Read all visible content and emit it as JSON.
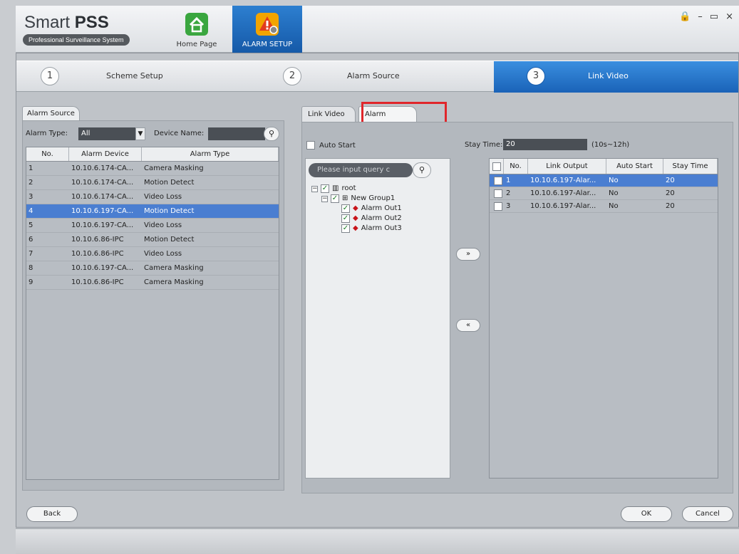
{
  "app": {
    "title_light": "Smart ",
    "title_bold": "PSS",
    "subtitle": "Professional Surveillance System"
  },
  "nav": {
    "home_label": "Home Page",
    "alarm_label": "ALARM SETUP"
  },
  "window_controls": {
    "lock": "🔒",
    "minimize": "–",
    "maximize": "▭",
    "close": "×"
  },
  "steps": [
    {
      "num": "1",
      "label": "Scheme Setup"
    },
    {
      "num": "2",
      "label": "Alarm Source"
    },
    {
      "num": "3",
      "label": "Link Video"
    }
  ],
  "alarm_source": {
    "tab_label": "Alarm Source",
    "alarm_type_label": "Alarm Type:",
    "alarm_type_value": "All",
    "device_name_label": "Device Name:",
    "columns": [
      "No.",
      "Alarm Device",
      "Alarm Type"
    ],
    "rows": [
      {
        "no": "1",
        "device": "10.10.6.174-CA...",
        "type": "Camera Masking"
      },
      {
        "no": "2",
        "device": "10.10.6.174-CA...",
        "type": "Motion Detect"
      },
      {
        "no": "3",
        "device": "10.10.6.174-CA...",
        "type": "Video Loss"
      },
      {
        "no": "4",
        "device": "10.10.6.197-CA...",
        "type": "Motion Detect"
      },
      {
        "no": "5",
        "device": "10.10.6.197-CA...",
        "type": "Video Loss"
      },
      {
        "no": "6",
        "device": "10.10.6.86-IPC",
        "type": "Motion Detect"
      },
      {
        "no": "7",
        "device": "10.10.6.86-IPC",
        "type": "Video Loss"
      },
      {
        "no": "8",
        "device": "10.10.6.197-CA...",
        "type": "Camera Masking"
      },
      {
        "no": "9",
        "device": "10.10.6.86-IPC",
        "type": "Camera Masking"
      }
    ],
    "selected_row": 3
  },
  "link": {
    "tab_link_video": "Link Video",
    "tab_alarm_output": "Alarm Output",
    "auto_start_label": "Auto Start",
    "search_placeholder": "Please input query c",
    "stay_time_label": "Stay Time:",
    "stay_time_value": "20",
    "stay_time_range": "(10s~12h)",
    "tree": {
      "root": "root",
      "group": "New Group1",
      "outputs": [
        "Alarm Out1",
        "Alarm Out2",
        "Alarm Out3"
      ]
    },
    "move_right": "»",
    "move_left": "«",
    "output_columns": [
      "No.",
      "Link Output",
      "Auto Start",
      "Stay Time"
    ],
    "output_rows": [
      {
        "no": "1",
        "output": "10.10.6.197-Alar...",
        "auto": "No",
        "stay": "20"
      },
      {
        "no": "2",
        "output": "10.10.6.197-Alar...",
        "auto": "No",
        "stay": "20"
      },
      {
        "no": "3",
        "output": "10.10.6.197-Alar...",
        "auto": "No",
        "stay": "20"
      }
    ],
    "selected_output_row": 0
  },
  "footer": {
    "back": "Back",
    "ok": "OK",
    "cancel": "Cancel"
  }
}
